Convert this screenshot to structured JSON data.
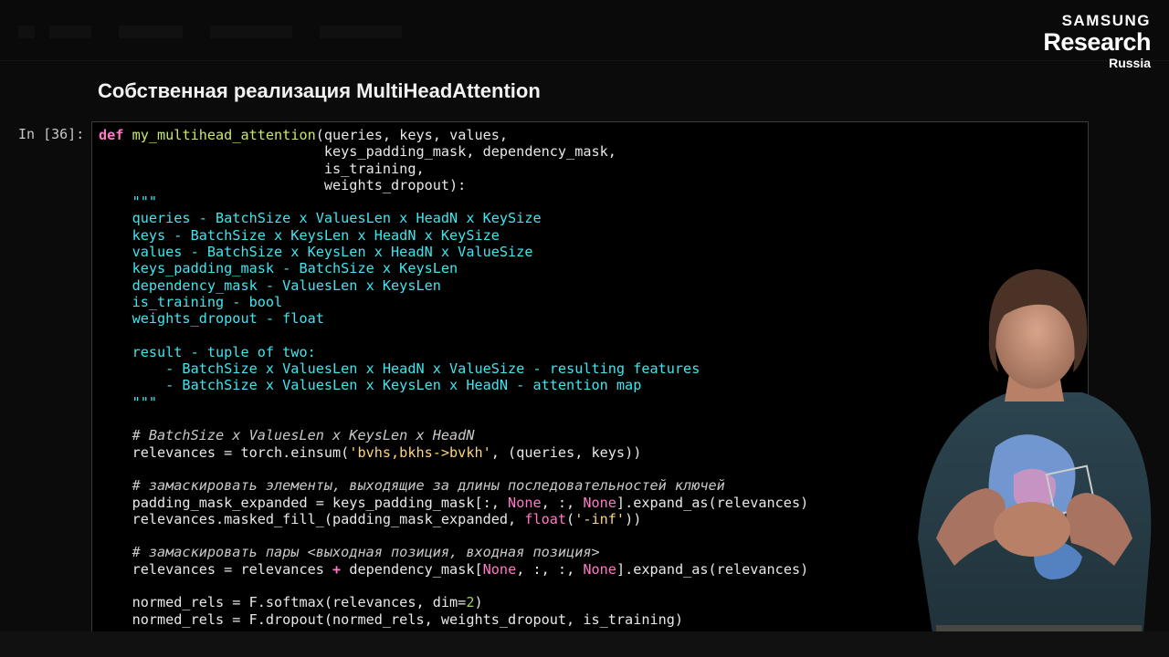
{
  "logo": {
    "line1": "SAMSUNG",
    "line2": "Research",
    "line3": "Russia"
  },
  "heading": "Собственная реализация MultiHeadAttention",
  "prompt": "In [36]:",
  "code": {
    "l1": {
      "kw": "def",
      "fn": "my_multihead_attention",
      "rest": "(queries, keys, values,"
    },
    "l2": "                           keys_padding_mask, dependency_mask,",
    "l3": "                           is_training,",
    "l4": "                           weights_dropout):",
    "doc": [
      "    \"\"\"",
      "    queries - BatchSize x ValuesLen x HeadN x KeySize",
      "    keys - BatchSize x KeysLen x HeadN x KeySize",
      "    values - BatchSize x KeysLen x HeadN x ValueSize",
      "    keys_padding_mask - BatchSize x KeysLen",
      "    dependency_mask - ValuesLen x KeysLen",
      "    is_training - bool",
      "    weights_dropout - float",
      "",
      "    result - tuple of two:",
      "        - BatchSize x ValuesLen x HeadN x ValueSize - resulting features",
      "        - BatchSize x ValuesLen x KeysLen x HeadN - attention map",
      "    \"\"\""
    ],
    "c1": "    # BatchSize x ValuesLen x KeysLen x HeadN",
    "e1": {
      "pre": "    relevances = torch.einsum(",
      "str": "'bvhs,bkhs->bvkh'",
      "post": ", (queries, keys))"
    },
    "c2": "    # замаскировать элементы, выходящие за длины последовательностей ключей",
    "p1": {
      "pre": "    padding_mask_expanded = keys_padding_mask[:, ",
      "none1": "None",
      "mid": ", :, ",
      "none2": "None",
      "post": "].expand_as(relevances)"
    },
    "p2": {
      "pre": "    relevances.masked_fill_(padding_mask_expanded, ",
      "builtin": "float",
      "lparen": "(",
      "str": "'-inf'",
      "post": "))"
    },
    "c3": "    # замаскировать пары <выходная позиция, входная позиция>",
    "d1": {
      "pre": "    relevances = relevances ",
      "op": "+",
      "mid": " dependency_mask[",
      "none1": "None",
      "mid2": ", :, :, ",
      "none2": "None",
      "post": "].expand_as(relevances)"
    },
    "s1": {
      "pre": "    normed_rels = F.softmax(relevances, dim=",
      "num": "2",
      "post": ")"
    },
    "s2": "    normed_rels = F.dropout(normed_rels, weights_dropout, is_training)"
  }
}
